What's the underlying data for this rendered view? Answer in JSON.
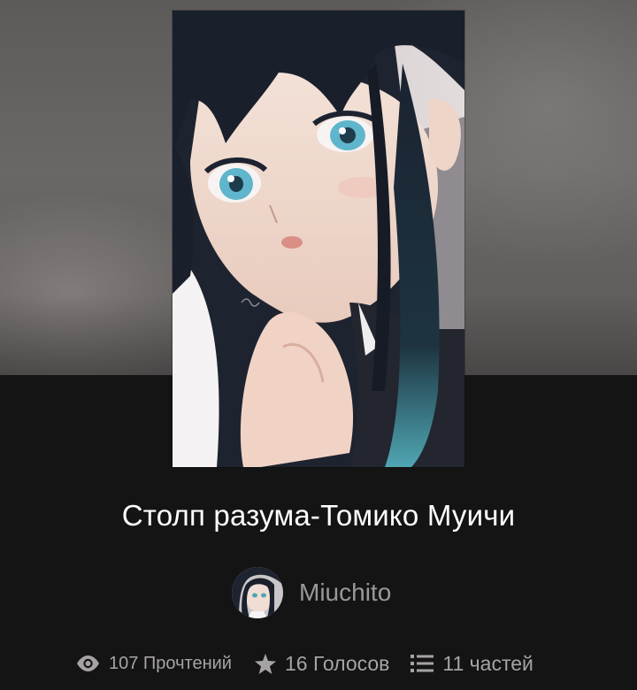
{
  "story": {
    "title": "Столп разума-Томико Муичи",
    "author": "Miuchito"
  },
  "stats": {
    "reads": "107 Прочтений",
    "votes": "16 Голосов",
    "parts": "11 частей",
    "reads_icon": "eye-icon",
    "votes_icon": "star-icon",
    "parts_icon": "list-icon"
  },
  "colors": {
    "background": "#151415",
    "title": "#ffffff",
    "muted": "#a6a3a3"
  }
}
